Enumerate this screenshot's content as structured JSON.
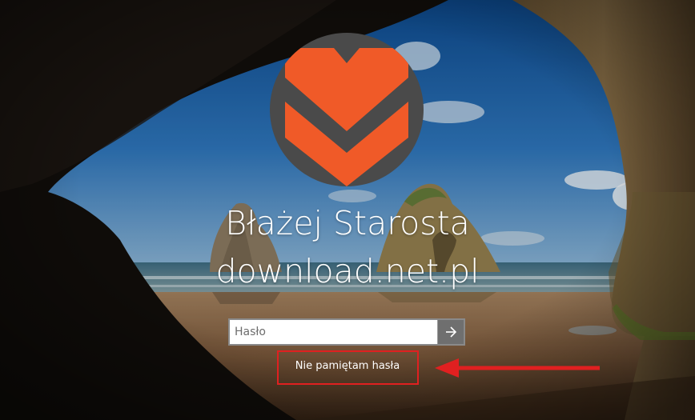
{
  "login": {
    "user_name_line1": "Błażej Starosta",
    "user_name_line2": "download.net.pl",
    "password_placeholder": "Hasło",
    "password_value": "",
    "submit_icon": "arrow-right-icon",
    "forgot_password_label": "Nie pamiętam hasła"
  },
  "avatar": {
    "icon": "chevron-logo-icon",
    "background_color": "#4a4a4a",
    "logo_color": "#f05a28"
  },
  "annotation": {
    "highlight_color": "#e02020"
  },
  "colors": {
    "text": "#ffffff",
    "submit_button_bg": "#6f6f6f"
  }
}
